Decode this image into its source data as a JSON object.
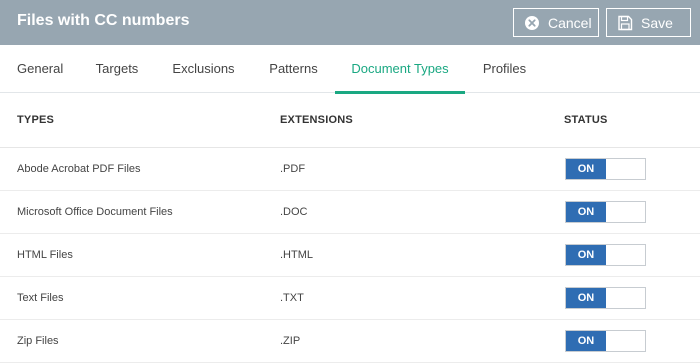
{
  "dialog": {
    "title": "Files with CC numbers",
    "cancel_label": "Cancel",
    "save_label": "Save"
  },
  "tabs": [
    {
      "label": "General"
    },
    {
      "label": "Targets"
    },
    {
      "label": "Exclusions"
    },
    {
      "label": "Patterns"
    },
    {
      "label": "Document Types",
      "active": true
    },
    {
      "label": "Profiles"
    }
  ],
  "table": {
    "headers": {
      "types": "TYPES",
      "extensions": "EXTENSIONS",
      "status": "STATUS"
    },
    "rows": [
      {
        "type": "Abode Acrobat PDF Files",
        "extension": ".PDF",
        "status": "ON"
      },
      {
        "type": "Microsoft Office Document Files",
        "extension": ".DOC",
        "status": "ON"
      },
      {
        "type": "HTML Files",
        "extension": ".HTML",
        "status": "ON"
      },
      {
        "type": "Text Files",
        "extension": ".TXT",
        "status": "ON"
      },
      {
        "type": "Zip Files",
        "extension": ".ZIP",
        "status": "ON"
      }
    ]
  },
  "colors": {
    "titlebar": "#97a6b1",
    "active_tab": "#1aa882",
    "toggle_on": "#2f6db3"
  },
  "icons": {
    "cancel": "close-circle-icon",
    "save": "floppy-disk-icon"
  }
}
